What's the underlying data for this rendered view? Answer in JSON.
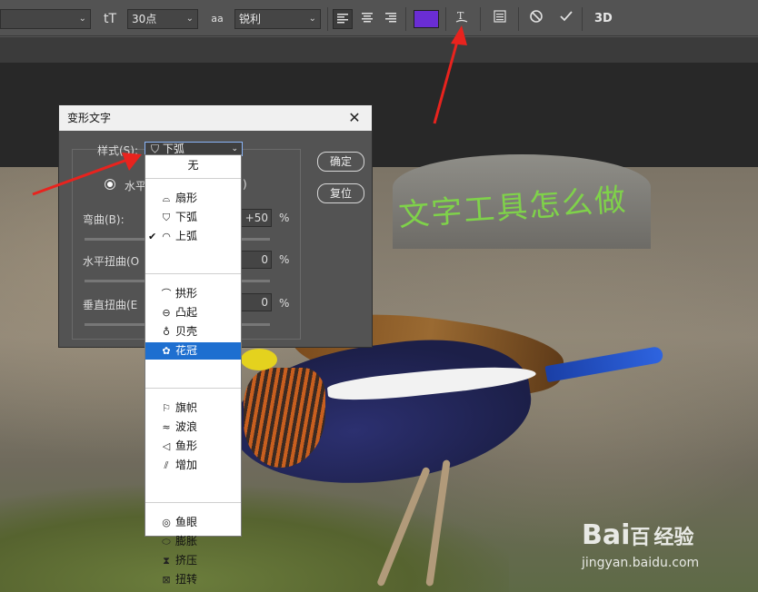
{
  "toolbar": {
    "font_size_icon": "tT",
    "font_size": "30点",
    "aa_icon": "aa",
    "antialias": "锐利",
    "three_d": "3D",
    "text_color": "#6a2dd4"
  },
  "dialog": {
    "title": "变形文字",
    "style_label": "样式(S):",
    "style_value": "下弧",
    "horizontal_label": "水平",
    "horizontal_suffix": ")",
    "bend_label": "弯曲(B):",
    "bend_value": "+50",
    "hdist_label": "水平扭曲(O",
    "hdist_value": "0",
    "vdist_label": "垂直扭曲(E",
    "vdist_value": "0",
    "percent": "%",
    "ok_label": "确定",
    "reset_label": "复位"
  },
  "style_menu": {
    "none": "无",
    "groups": [
      [
        {
          "label": "扇形",
          "icon": "arc-icon"
        },
        {
          "label": "下弧",
          "icon": "arc-lower-icon"
        },
        {
          "label": "上弧",
          "icon": "arc-upper-icon",
          "checked": true
        }
      ],
      [
        {
          "label": "拱形",
          "icon": "arch-icon"
        },
        {
          "label": "凸起",
          "icon": "bulge-icon"
        },
        {
          "label": "贝壳",
          "icon": "shell-icon"
        },
        {
          "label": "花冠",
          "icon": "flower-icon",
          "selected": true
        }
      ],
      [
        {
          "label": "旗帜",
          "icon": "flag-icon"
        },
        {
          "label": "波浪",
          "icon": "wave-icon"
        },
        {
          "label": "鱼形",
          "icon": "fish-icon"
        },
        {
          "label": "增加",
          "icon": "rise-icon"
        }
      ],
      [
        {
          "label": "鱼眼",
          "icon": "fisheye-icon"
        },
        {
          "label": "膨胀",
          "icon": "inflate-icon"
        },
        {
          "label": "挤压",
          "icon": "squeeze-icon"
        },
        {
          "label": "扭转",
          "icon": "twist-icon"
        }
      ]
    ]
  },
  "canvas": {
    "warped_text": "文字工具怎么做",
    "text_color": "#7fd24a"
  },
  "watermark": {
    "logo_left": "Bai",
    "logo_right": "百",
    "logo_suffix": "经验",
    "url": "jingyan.baidu.com"
  },
  "colors": {
    "accent_red": "#e8231e",
    "selection_blue": "#1e6fd0"
  }
}
